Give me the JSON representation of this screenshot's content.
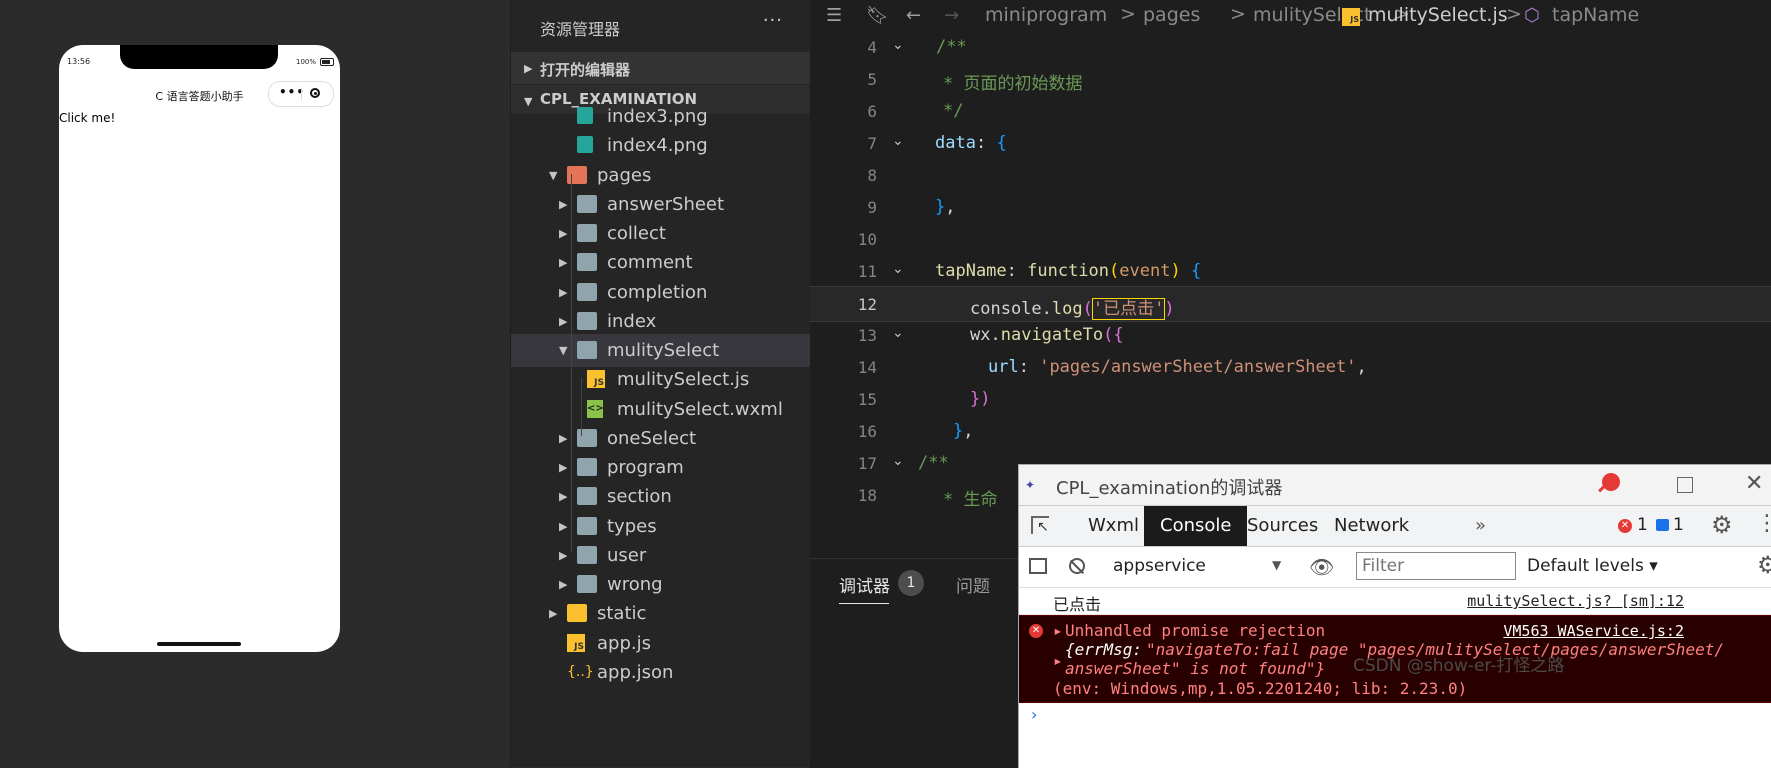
{
  "simulator": {
    "status_time": "13:56",
    "battery": "100%",
    "nav_title": "C 语言答题小助手",
    "capsule_more": "•••",
    "content_text": "Click me!"
  },
  "explorer": {
    "title": "资源管理器",
    "more": "···",
    "open_editors": "打开的编辑器",
    "project": "CPL_EXAMINATION",
    "tree": [
      {
        "label": "index3.png",
        "kind": "image",
        "depth": 3
      },
      {
        "label": "index4.png",
        "kind": "image",
        "depth": 3
      },
      {
        "label": "pages",
        "kind": "folder-red",
        "depth": 2,
        "expanded": true
      },
      {
        "label": "answerSheet",
        "kind": "folder",
        "depth": 3
      },
      {
        "label": "collect",
        "kind": "folder",
        "depth": 3
      },
      {
        "label": "comment",
        "kind": "folder",
        "depth": 3
      },
      {
        "label": "completion",
        "kind": "folder",
        "depth": 3
      },
      {
        "label": "index",
        "kind": "folder",
        "depth": 3
      },
      {
        "label": "mulitySelect",
        "kind": "folder-open",
        "depth": 3,
        "expanded": true,
        "selected": true
      },
      {
        "label": "mulitySelect.js",
        "kind": "js",
        "depth": 4
      },
      {
        "label": "mulitySelect.wxml",
        "kind": "wxml",
        "depth": 4
      },
      {
        "label": "oneSelect",
        "kind": "folder",
        "depth": 3
      },
      {
        "label": "program",
        "kind": "folder",
        "depth": 3
      },
      {
        "label": "section",
        "kind": "folder",
        "depth": 3
      },
      {
        "label": "types",
        "kind": "folder",
        "depth": 3
      },
      {
        "label": "user",
        "kind": "folder",
        "depth": 3
      },
      {
        "label": "wrong",
        "kind": "folder",
        "depth": 3
      },
      {
        "label": "static",
        "kind": "folder-yellow",
        "depth": 2
      },
      {
        "label": "app.js",
        "kind": "js",
        "depth": 2
      },
      {
        "label": "app.json",
        "kind": "json",
        "depth": 2
      }
    ]
  },
  "breadcrumb": {
    "items": [
      "miniprogram",
      "pages",
      "mulitySelect",
      "mulitySelect.js",
      "tapName"
    ],
    "separator": ">"
  },
  "code": {
    "current_line": "12",
    "lines": [
      {
        "num": "4",
        "fold": true
      },
      {
        "num": "5"
      },
      {
        "num": "6"
      },
      {
        "num": "7",
        "fold": true
      },
      {
        "num": "8"
      },
      {
        "num": "9"
      },
      {
        "num": "10"
      },
      {
        "num": "11",
        "fold": true
      },
      {
        "num": "12"
      },
      {
        "num": "13",
        "fold": true
      },
      {
        "num": "14"
      },
      {
        "num": "15"
      },
      {
        "num": "16"
      },
      {
        "num": "17",
        "fold": true
      },
      {
        "num": "18"
      }
    ],
    "tokens": {
      "l4": "/**",
      "l5": "* 页面的初始数据",
      "l6": "*/",
      "l7_key": "data",
      "l7_rest": ": ",
      "l7_brace": "{",
      "l9_brace": "}",
      "l9_comma": ",",
      "l11_key": "tapName",
      "l11_colon": ": ",
      "l11_fn": "function",
      "l11_paren_open": "(",
      "l11_param": "event",
      "l11_paren_close": ")",
      "l11_brace": " {",
      "l12_obj": "console",
      "l12_dot": ".",
      "l12_method": "log",
      "l12_paren_open": "(",
      "l12_str": "'已点击'",
      "l12_paren_close": ")",
      "l13_obj": "wx",
      "l13_dot": ".",
      "l13_method": "navigateTo",
      "l13_open": "({",
      "l14_key": "url",
      "l14_colon": ": ",
      "l14_str": "'pages/answerSheet/answerSheet'",
      "l14_comma": ",",
      "l15": "})",
      "l16_brace": "}",
      "l16_comma": ",",
      "l17": "/**",
      "l18": "* 生命"
    }
  },
  "panel": {
    "tab_debugger": "调试器",
    "badge": "1",
    "tab_issues": "问题"
  },
  "devtools": {
    "title": "CPL_examination的调试器",
    "tabs": [
      "Wxml",
      "Console",
      "Sources",
      "Network"
    ],
    "active_tab": "Console",
    "more_tabs": "»",
    "error_count": "1",
    "message_count": "1",
    "context": "appservice",
    "filter_placeholder": "Filter",
    "levels": "Default levels ▾",
    "log": {
      "message": "已点击",
      "source": "mulitySelect.js? [sm]:12"
    },
    "error": {
      "line1": "Unhandled promise rejection",
      "source": "VM563 WAService.js:2",
      "line2_key": "{errMsg: ",
      "line2_val": "\"navigateTo:fail page \"pages/mulitySelect/pages/answerSheet/",
      "line3": "answerSheet\" is not found\"}",
      "line4": "(env: Windows,mp,1.05.2201240; lib: 2.23.0)"
    },
    "prompt": "›"
  },
  "watermark": "CSDN @show-er-打怪之路",
  "colors": {
    "accent": "#1a73e8",
    "error_bg": "#290000",
    "editor_bg": "#1e1e1e",
    "sidebar_bg": "#252526"
  }
}
